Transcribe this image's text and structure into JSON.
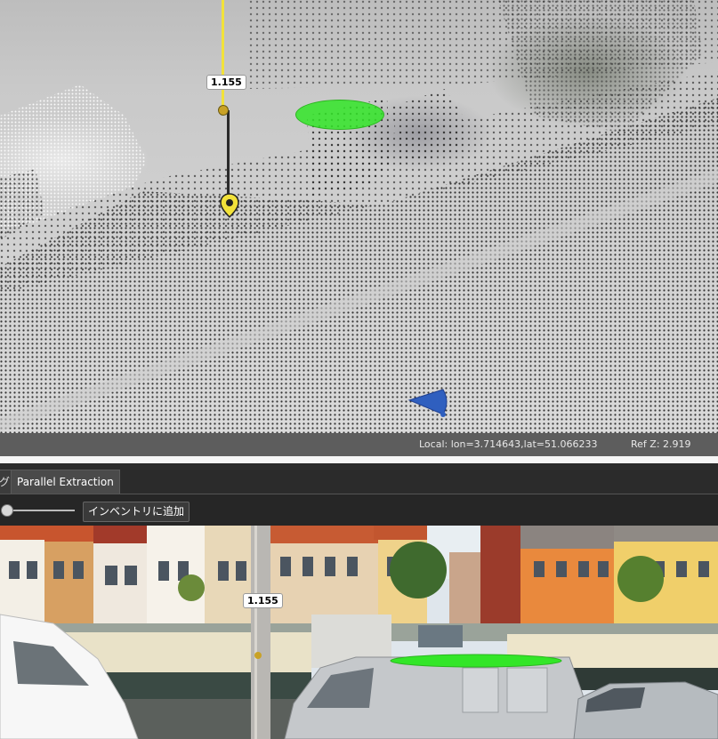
{
  "point_cloud": {
    "measurement_label": "1.155",
    "status_local": "Local: lon=3.714643,lat=51.066233",
    "status_refz": "Ref Z: 2.919"
  },
  "tabs": {
    "partial_tab": "グ",
    "active_tab": "Parallel Extraction"
  },
  "toolbar": {
    "add_inventory_label": "インベントリに追加"
  },
  "photo": {
    "measurement_label": "1.155"
  },
  "colors": {
    "disc_green": "#33e628",
    "marker_yellow": "#f2e23a",
    "cone_blue": "#2f5fbf"
  }
}
